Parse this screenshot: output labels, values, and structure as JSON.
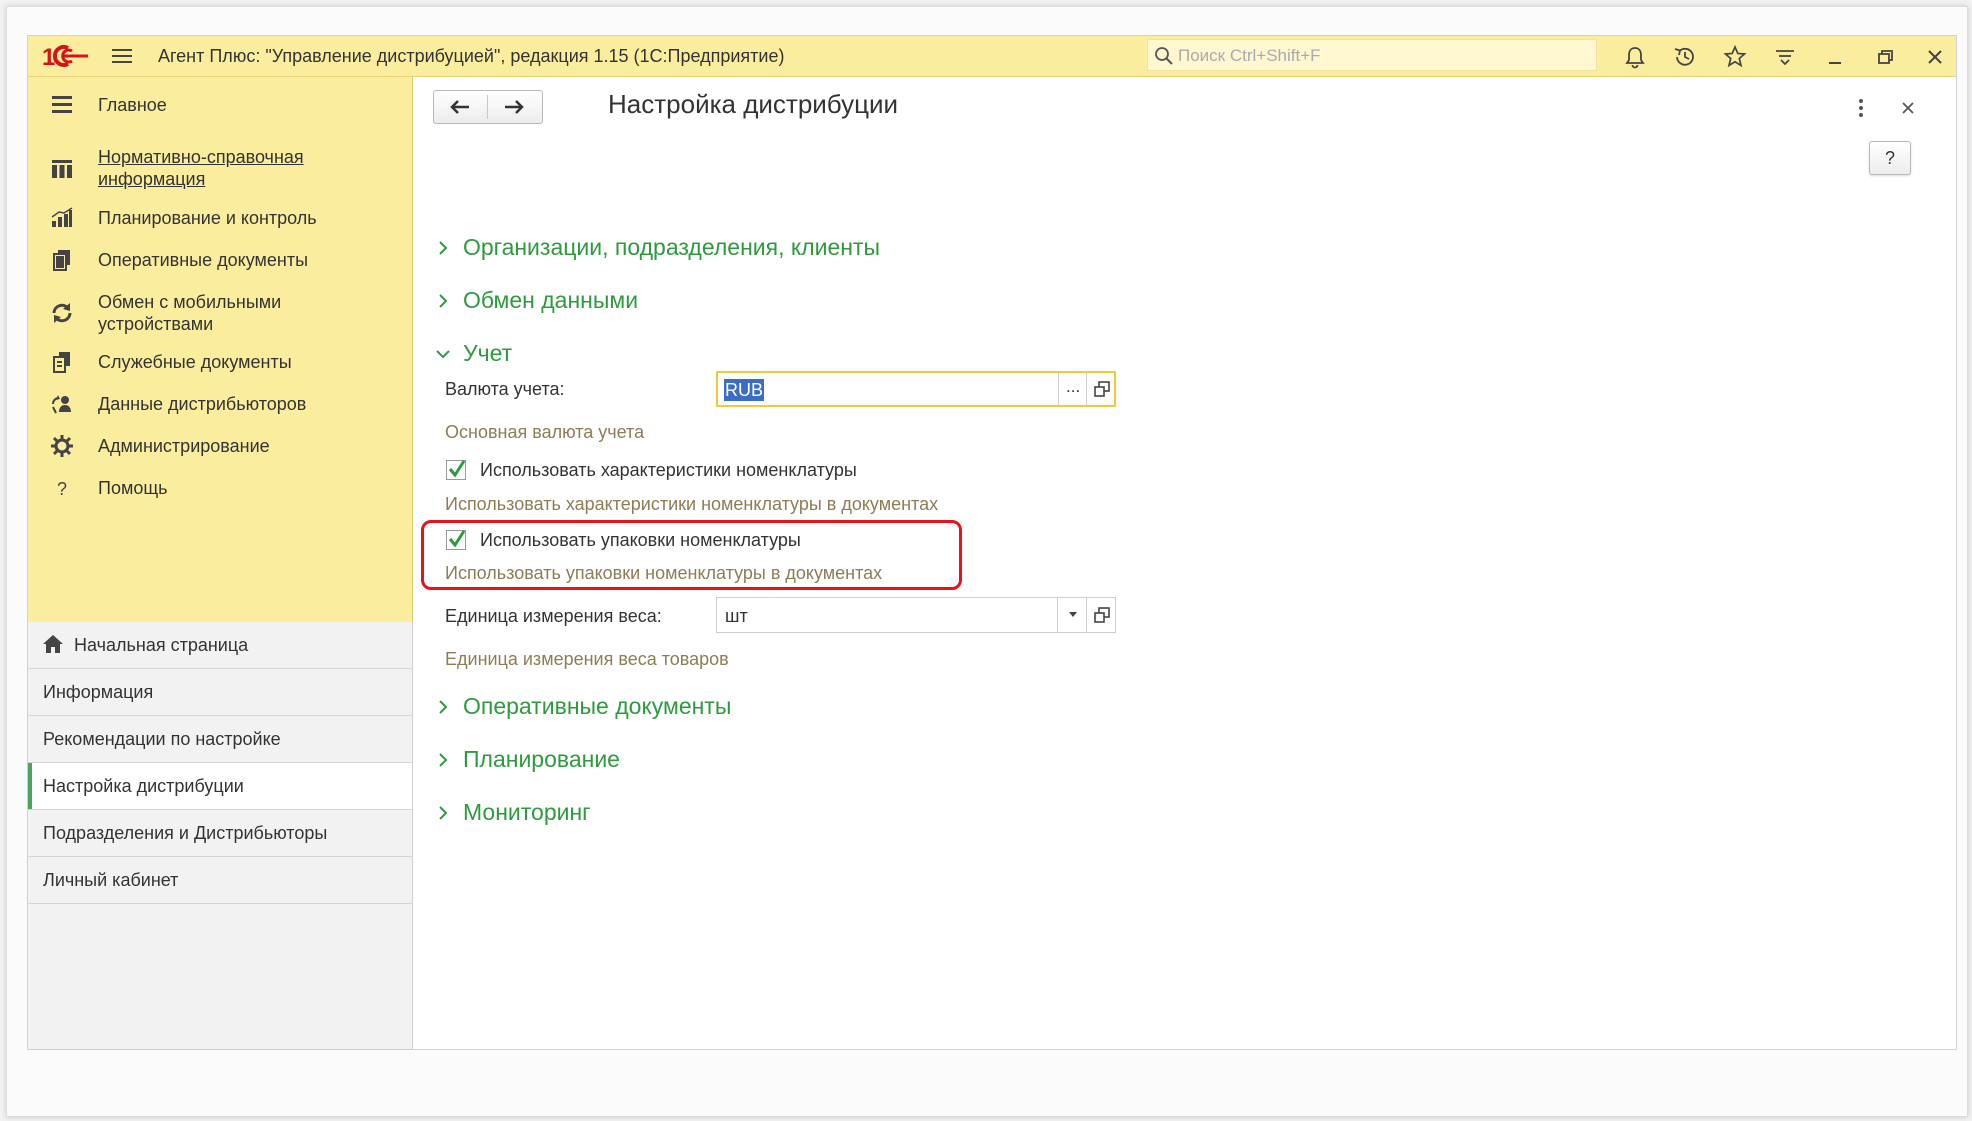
{
  "titlebar": {
    "app_title": "Агент Плюс: \"Управление дистрибуцией\", редакция 1.15  (1С:Предприятие)",
    "search_placeholder": "Поиск Ctrl+Shift+F",
    "logo_text": "1С"
  },
  "sections": {
    "items": [
      {
        "label": "Главное",
        "icon": "list-icon"
      },
      {
        "label": "Нормативно-справочная информация",
        "icon": "reference-grid-icon"
      },
      {
        "label": "Планирование и контроль",
        "icon": "chart-icon"
      },
      {
        "label": "Оперативные документы",
        "icon": "documents-icon"
      },
      {
        "label": "Обмен с мобильными устройствами",
        "icon": "sync-icon"
      },
      {
        "label": "Служебные документы",
        "icon": "service-docs-icon"
      },
      {
        "label": "Данные дистрибьюторов",
        "icon": "distributor-data-icon"
      },
      {
        "label": "Администрирование",
        "icon": "gear-icon"
      },
      {
        "label": "Помощь",
        "icon": "question-icon"
      }
    ]
  },
  "open_windows": {
    "items": [
      {
        "label": "Начальная страница",
        "icon": "home-icon"
      },
      {
        "label": "Информация"
      },
      {
        "label": "Рекомендации по настройке"
      },
      {
        "label": "Настройка дистрибуции",
        "active": true
      },
      {
        "label": "Подразделения и Дистрибьюторы"
      },
      {
        "label": "Личный кабинет"
      }
    ]
  },
  "form": {
    "title": "Настройка дистрибуции",
    "help_label": "?",
    "groups": {
      "orgs": "Организации, подразделения, клиенты",
      "exchange": "Обмен данными",
      "accounting": "Учет",
      "operational": "Оперативные документы",
      "planning": "Планирование",
      "monitoring": "Мониторинг"
    },
    "accounting": {
      "currency_label": "Валюта учета:",
      "currency_value": "RUB",
      "currency_hint": "Основная валюта учета",
      "characteristics_label": "Использовать характеристики номенклатуры",
      "characteristics_checked": true,
      "characteristics_hint": "Использовать характеристики номенклатуры в документах",
      "packages_label": "Использовать упаковки номенклатуры",
      "packages_checked": true,
      "packages_hint": "Использовать упаковки номенклатуры в документах",
      "weight_unit_label": "Единица измерения веса:",
      "weight_unit_value": "шт",
      "weight_unit_hint": "Единица измерения веса товаров",
      "select_button_label": "..."
    }
  },
  "colors": {
    "accent_green": "#2e9a3e",
    "titlebar_bg": "#fbed9e",
    "highlight_red": "#e8131a",
    "hint_text": "#8c7d55"
  }
}
